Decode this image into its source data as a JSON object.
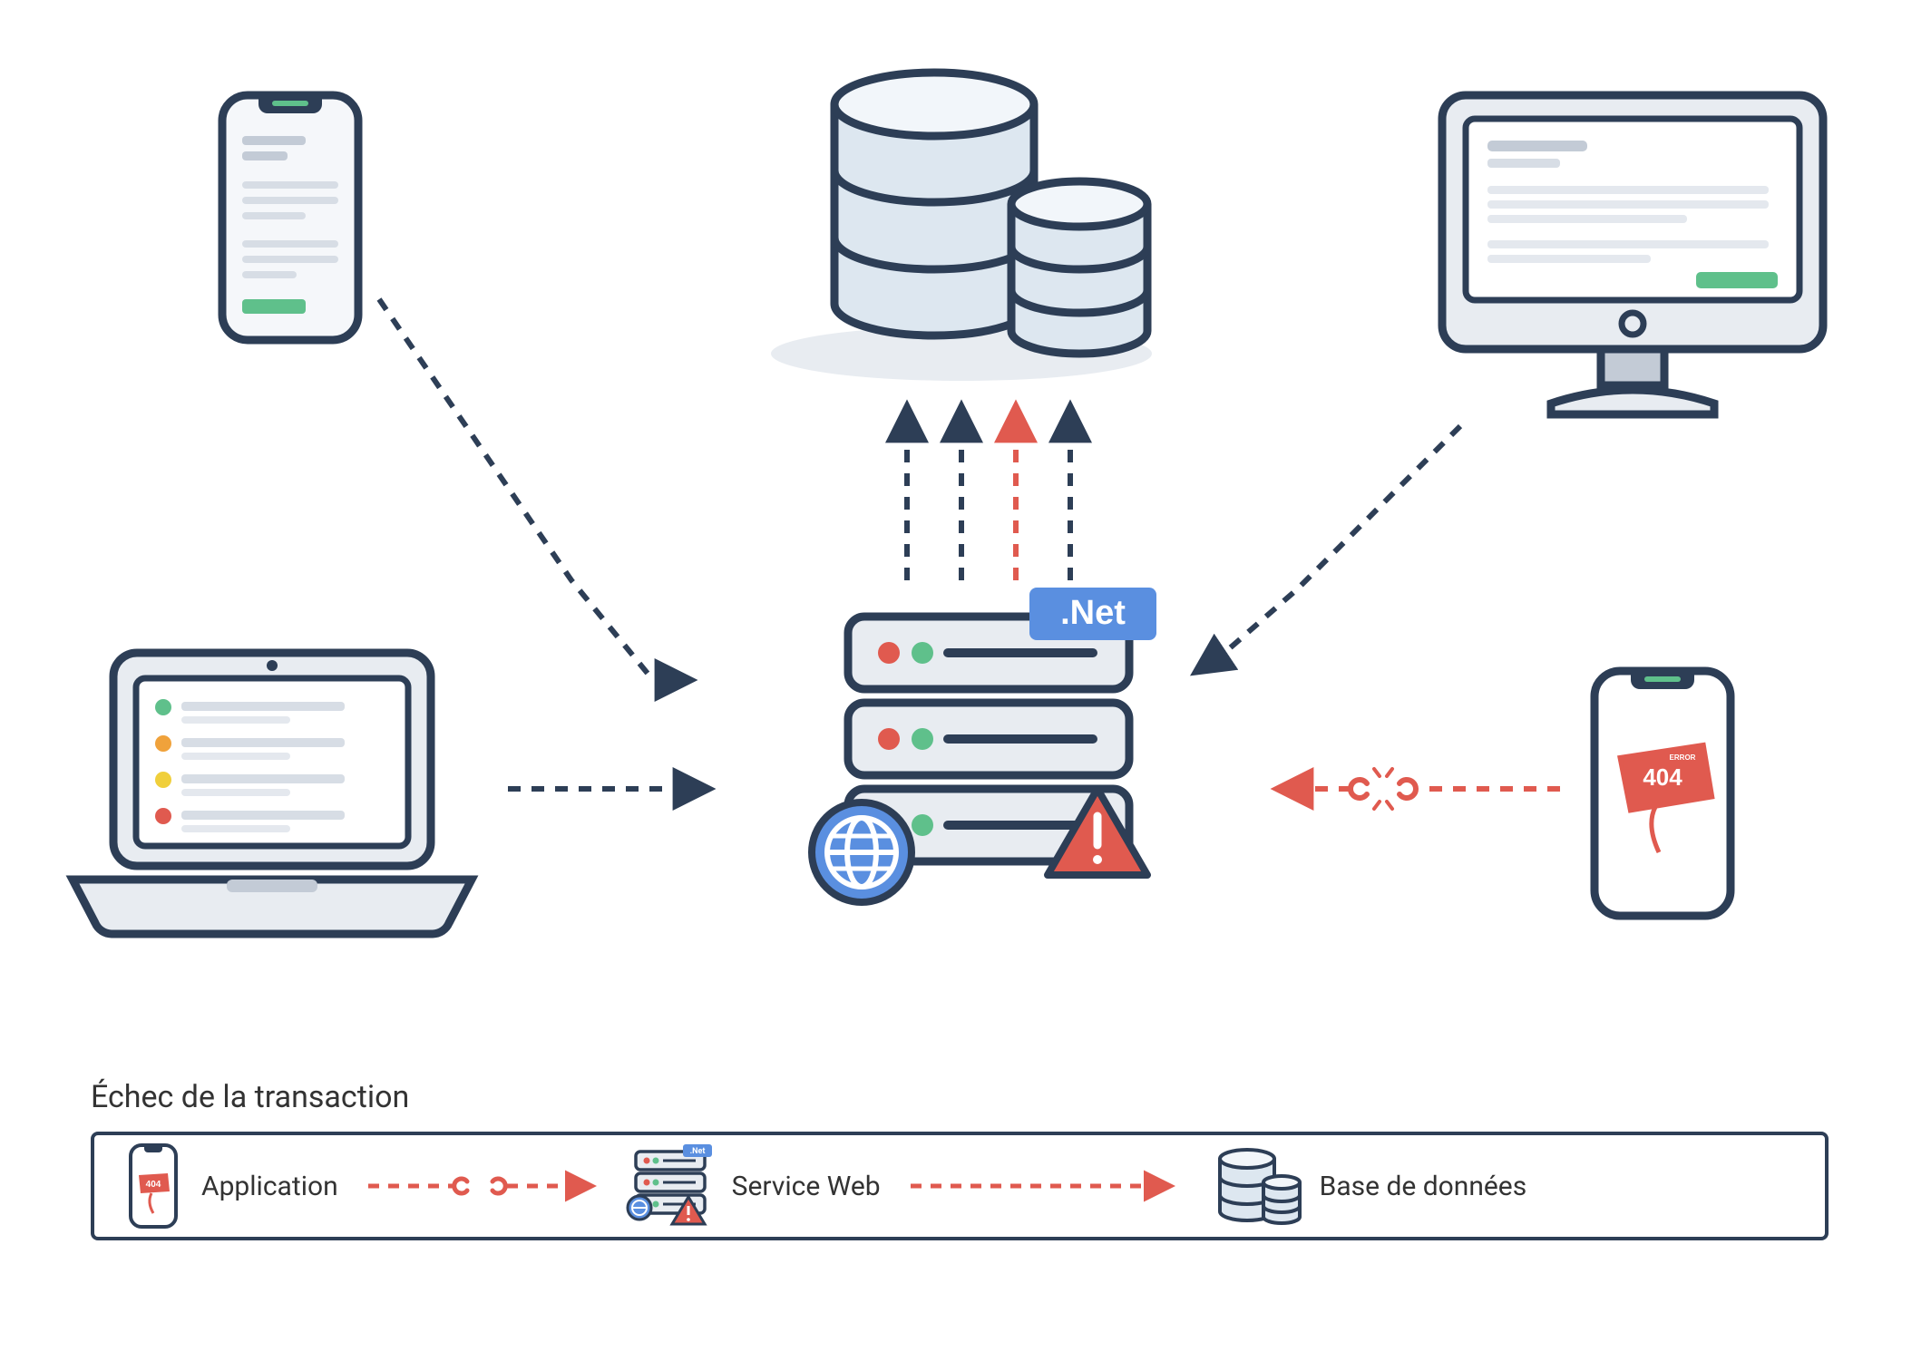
{
  "diagram": {
    "server_badge": ".Net",
    "error_badge": "404",
    "error_badge_small": "ERROR"
  },
  "legend": {
    "title": "Échec de la transaction",
    "items": [
      {
        "label": "Application"
      },
      {
        "label": "Service Web"
      },
      {
        "label": "Base de données"
      }
    ]
  }
}
